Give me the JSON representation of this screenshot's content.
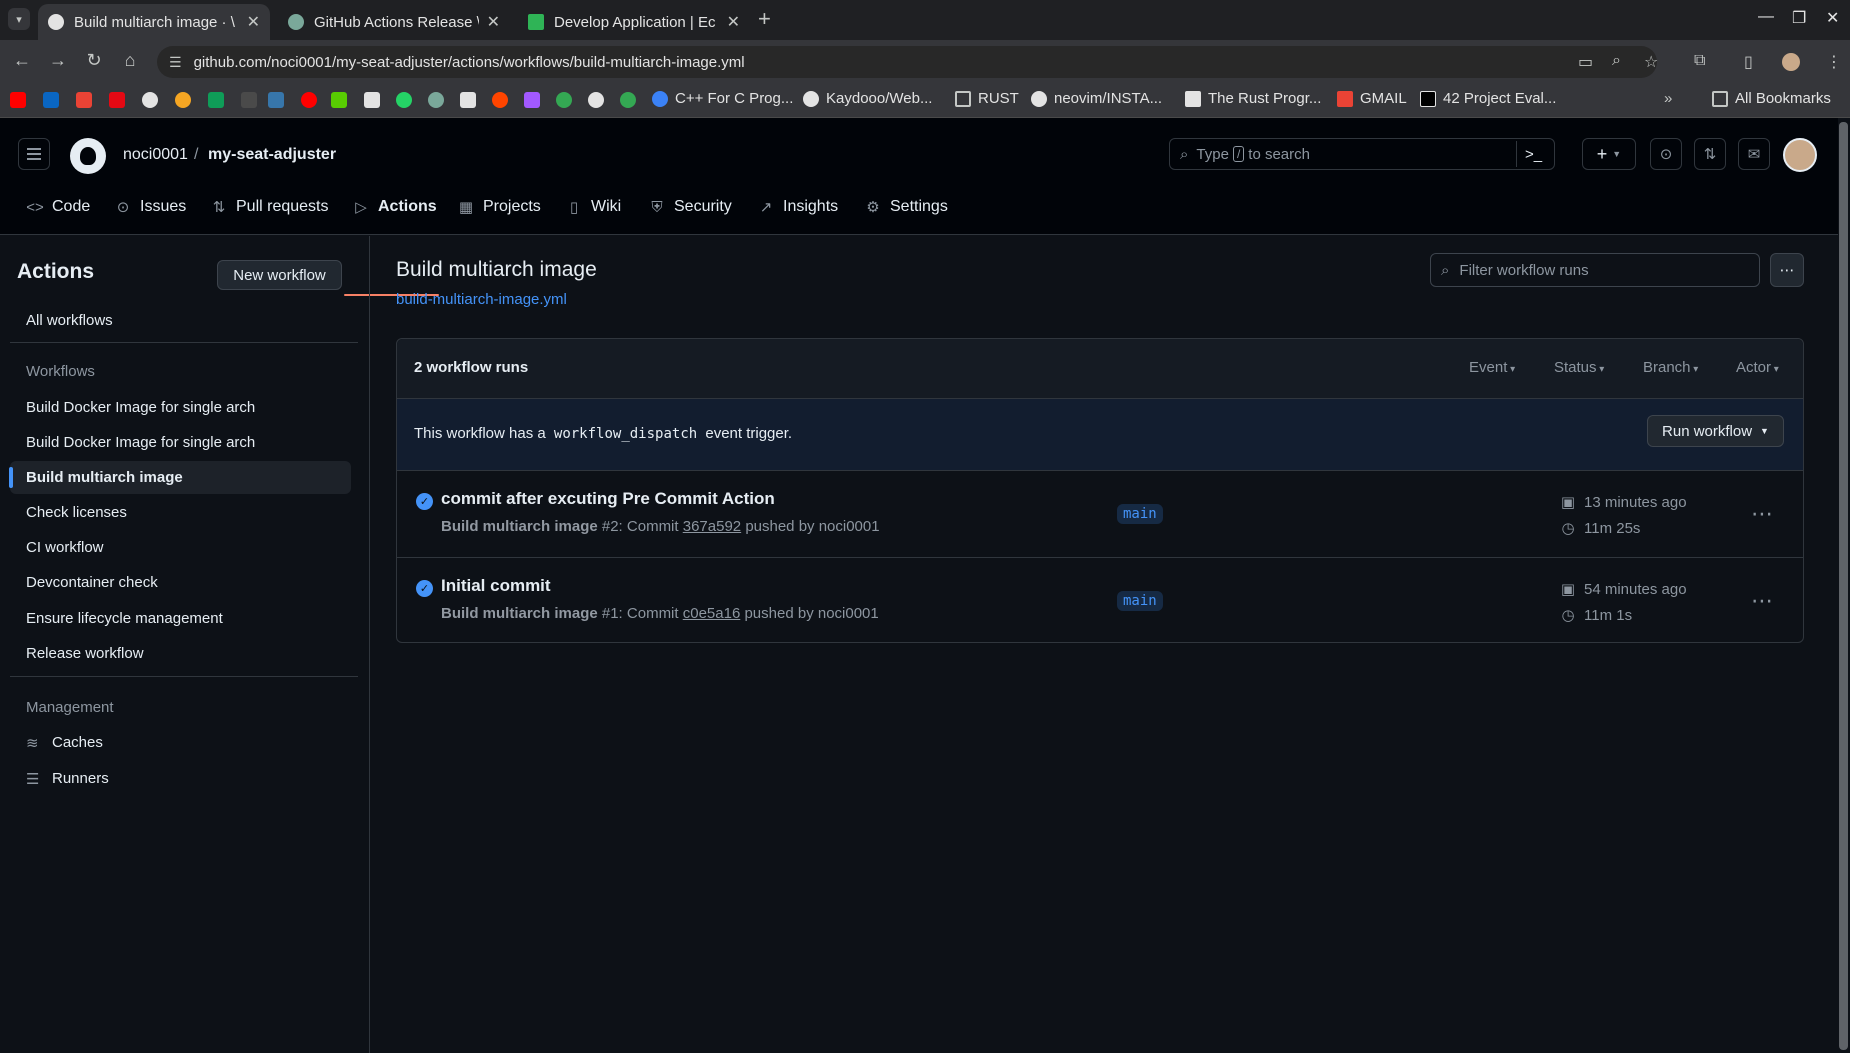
{
  "browser": {
    "tabs": [
      {
        "title": "Build multiarch image · \\",
        "active": true
      },
      {
        "title": "GitHub Actions Release \\",
        "active": false
      },
      {
        "title": "Develop Application | Ec",
        "active": false
      }
    ],
    "url": "github.com/noci0001/my-seat-adjuster/actions/workflows/build-multiarch-image.yml",
    "bookmarks": [
      {
        "label": "C++ For C Prog..."
      },
      {
        "label": "Kaydooo/Web..."
      },
      {
        "label": "RUST"
      },
      {
        "label": "neovim/INSTA..."
      },
      {
        "label": "The Rust Progr..."
      },
      {
        "label": "GMAIL"
      },
      {
        "label": "42 Project Eval..."
      }
    ],
    "all_bookmarks": "All Bookmarks"
  },
  "header": {
    "owner": "noci0001",
    "separator": "/",
    "repo": "my-seat-adjuster",
    "search_pre": "Type",
    "search_key": "/",
    "search_post": "to search",
    "plus": "+"
  },
  "repo_nav": [
    {
      "label": "Code",
      "icon": "code-icon"
    },
    {
      "label": "Issues",
      "icon": "issue-icon"
    },
    {
      "label": "Pull requests",
      "icon": "pull-request-icon"
    },
    {
      "label": "Actions",
      "icon": "play-icon"
    },
    {
      "label": "Projects",
      "icon": "table-icon"
    },
    {
      "label": "Wiki",
      "icon": "book-icon"
    },
    {
      "label": "Security",
      "icon": "shield-icon"
    },
    {
      "label": "Insights",
      "icon": "graph-icon"
    },
    {
      "label": "Settings",
      "icon": "gear-icon"
    }
  ],
  "sidebar": {
    "title": "Actions",
    "new_workflow": "New workflow",
    "all_workflows": "All workflows",
    "workflows_heading": "Workflows",
    "workflows": [
      "Build Docker Image for single arch",
      "Build Docker Image for single arch",
      "Build multiarch image",
      "Check licenses",
      "CI workflow",
      "Devcontainer check",
      "Ensure lifecycle management",
      "Release workflow"
    ],
    "management_heading": "Management",
    "management": [
      "Caches",
      "Runners"
    ]
  },
  "main": {
    "title": "Build multiarch image",
    "file": "build-multiarch-image.yml",
    "filter_placeholder": "Filter workflow runs",
    "run_count": "2 workflow runs",
    "filters": [
      "Event",
      "Status",
      "Branch",
      "Actor"
    ],
    "dispatch_pre": "This workflow has a",
    "dispatch_code": "workflow_dispatch",
    "dispatch_post": "event trigger.",
    "run_workflow": "Run workflow",
    "runs": [
      {
        "title": "commit after excuting Pre Commit Action",
        "workflow": "Build multiarch image",
        "number": "#2: Commit",
        "sha": "367a592",
        "pushed_by": "pushed by noci0001",
        "branch": "main",
        "when": "13 minutes ago",
        "duration": "11m 25s"
      },
      {
        "title": "Initial commit",
        "workflow": "Build multiarch image",
        "number": "#1: Commit",
        "sha": "c0e5a16",
        "pushed_by": "pushed by noci0001",
        "branch": "main",
        "when": "54 minutes ago",
        "duration": "11m 1s"
      }
    ]
  }
}
